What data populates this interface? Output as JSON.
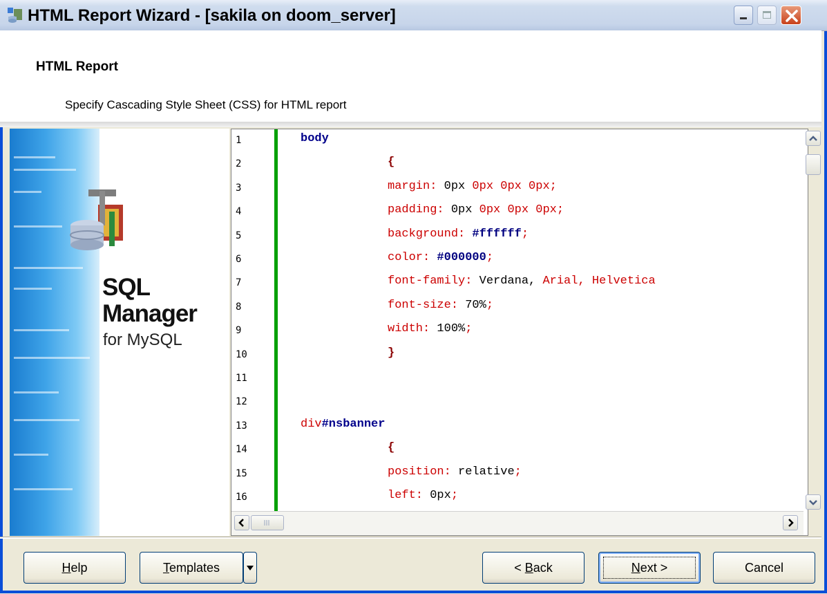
{
  "window": {
    "title": "HTML Report Wizard - [sakila on doom_server]",
    "controls": [
      "minimize",
      "maximize",
      "close"
    ]
  },
  "header": {
    "heading": "HTML Report",
    "subheading": "Specify Cascading Style Sheet (CSS) for HTML report"
  },
  "banner": {
    "line1": "SQL",
    "line2": "Manager",
    "line3": "for MySQL"
  },
  "editor": {
    "line_numbers": [
      "1",
      "2",
      "3",
      "4",
      "5",
      "6",
      "7",
      "8",
      "9",
      "10",
      "11",
      "12",
      "13",
      "14",
      "15",
      "16"
    ],
    "lines": [
      {
        "tokens": [
          {
            "t": "body",
            "c": "sel"
          }
        ],
        "indent": 0
      },
      {
        "tokens": [
          {
            "t": "{",
            "c": "brace"
          }
        ],
        "indent": 1
      },
      {
        "tokens": [
          {
            "t": "margin:",
            "c": "prop"
          },
          {
            "t": " 0px",
            "c": "val"
          },
          {
            "t": " 0px 0px 0px;",
            "c": "prop"
          }
        ],
        "indent": 1
      },
      {
        "tokens": [
          {
            "t": "padding:",
            "c": "prop"
          },
          {
            "t": " 0px",
            "c": "val"
          },
          {
            "t": " 0px 0px 0px;",
            "c": "prop"
          }
        ],
        "indent": 1
      },
      {
        "tokens": [
          {
            "t": "background:",
            "c": "prop"
          },
          {
            "t": " #ffffff",
            "c": "hexv"
          },
          {
            "t": ";",
            "c": "prop"
          }
        ],
        "indent": 1
      },
      {
        "tokens": [
          {
            "t": "color:",
            "c": "prop"
          },
          {
            "t": " #000000",
            "c": "hexv"
          },
          {
            "t": ";",
            "c": "prop"
          }
        ],
        "indent": 1
      },
      {
        "tokens": [
          {
            "t": "font-family:",
            "c": "prop"
          },
          {
            "t": " Verdana,",
            "c": "val"
          },
          {
            "t": " Arial,",
            "c": "prop"
          },
          {
            "t": " Helvetica",
            "c": "prop"
          }
        ],
        "indent": 1
      },
      {
        "tokens": [
          {
            "t": "font-size:",
            "c": "prop"
          },
          {
            "t": " 70%",
            "c": "val"
          },
          {
            "t": ";",
            "c": "prop"
          }
        ],
        "indent": 1
      },
      {
        "tokens": [
          {
            "t": "width:",
            "c": "prop"
          },
          {
            "t": " 100%",
            "c": "val"
          },
          {
            "t": ";",
            "c": "prop"
          }
        ],
        "indent": 1
      },
      {
        "tokens": [
          {
            "t": "}",
            "c": "brace"
          }
        ],
        "indent": 1
      },
      {
        "tokens": [],
        "indent": 0
      },
      {
        "tokens": [],
        "indent": 0
      },
      {
        "tokens": [
          {
            "t": "div",
            "c": "prop"
          },
          {
            "t": "#nsbanner",
            "c": "sel"
          }
        ],
        "indent": 0
      },
      {
        "tokens": [
          {
            "t": "{",
            "c": "brace"
          }
        ],
        "indent": 1
      },
      {
        "tokens": [
          {
            "t": "position:",
            "c": "prop"
          },
          {
            "t": " relative",
            "c": "val"
          },
          {
            "t": ";",
            "c": "prop"
          }
        ],
        "indent": 1
      },
      {
        "tokens": [
          {
            "t": "left:",
            "c": "prop"
          },
          {
            "t": " 0px",
            "c": "val"
          },
          {
            "t": ";",
            "c": "prop"
          }
        ],
        "indent": 1
      }
    ]
  },
  "buttons": {
    "help": {
      "mnemonic": "H",
      "rest": "elp"
    },
    "templates": {
      "mnemonic": "T",
      "rest": "emplates"
    },
    "back": {
      "prefix": "< ",
      "mnemonic": "B",
      "rest": "ack"
    },
    "next": {
      "mnemonic": "N",
      "rest": "ext >"
    },
    "cancel": "Cancel"
  },
  "icons": {
    "app": "database-wizard-icon",
    "product": "database-tools-icon",
    "scroll_up": "chevron-up-icon",
    "scroll_down": "chevron-down-icon",
    "scroll_left": "chevron-left-icon",
    "scroll_right": "chevron-right-icon",
    "templates_dropdown": "triangle-down-icon"
  },
  "colors": {
    "selector": "#00008b",
    "property": "#cc0000",
    "gutter_bar": "#00a000",
    "window_border": "#0a4ed8"
  }
}
